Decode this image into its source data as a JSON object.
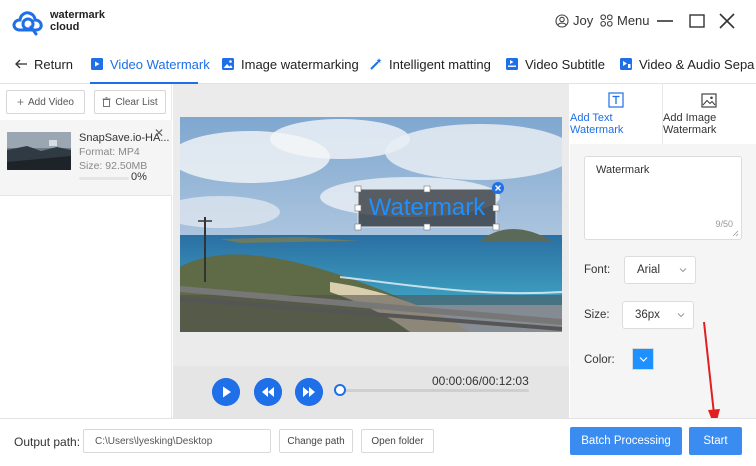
{
  "app": {
    "logo_line1": "watermark",
    "logo_line2": "cloud"
  },
  "header": {
    "user_name": "Joy",
    "menu_label": "Menu"
  },
  "tabs": [
    {
      "label": "Return"
    },
    {
      "label": "Video Watermark",
      "active": true
    },
    {
      "label": "Image watermarking"
    },
    {
      "label": "Intelligent matting"
    },
    {
      "label": "Video Subtitle"
    },
    {
      "label": "Video & Audio Sepa"
    }
  ],
  "left_panel": {
    "add_video_label": "Add Video",
    "clear_list_label": "Clear List",
    "file": {
      "name": "SnapSave.io-HA...",
      "format": "Format:  MP4",
      "size": "Size:  92.50MB",
      "progress": "0%"
    }
  },
  "preview": {
    "watermark_overlay": "Watermark"
  },
  "player": {
    "timecode": "00:00:06/00:12:03",
    "progress_fraction": 0.008
  },
  "right_panel": {
    "tab_text_line1": "Add Text",
    "tab_text_line2": "Watermark",
    "tab_image_line1": "Add Image",
    "tab_image_line2": "Watermark",
    "watermark_text": "Watermark",
    "char_count": "9/50",
    "font_label": "Font:",
    "font_value": "Arial",
    "size_label": "Size:",
    "size_value": "36px",
    "color_label": "Color:",
    "color_value": "#1e90ff"
  },
  "bottom": {
    "output_label": "Output path:",
    "output_path": "C:\\Users\\lyesking\\Desktop",
    "change_path_label": "Change path",
    "open_folder_label": "Open folder",
    "batch_label": "Batch Processing",
    "start_label": "Start"
  },
  "colors": {
    "accent": "#1e6fe8",
    "button": "#3b8cf0",
    "annotation_arrow": "#e02020"
  }
}
